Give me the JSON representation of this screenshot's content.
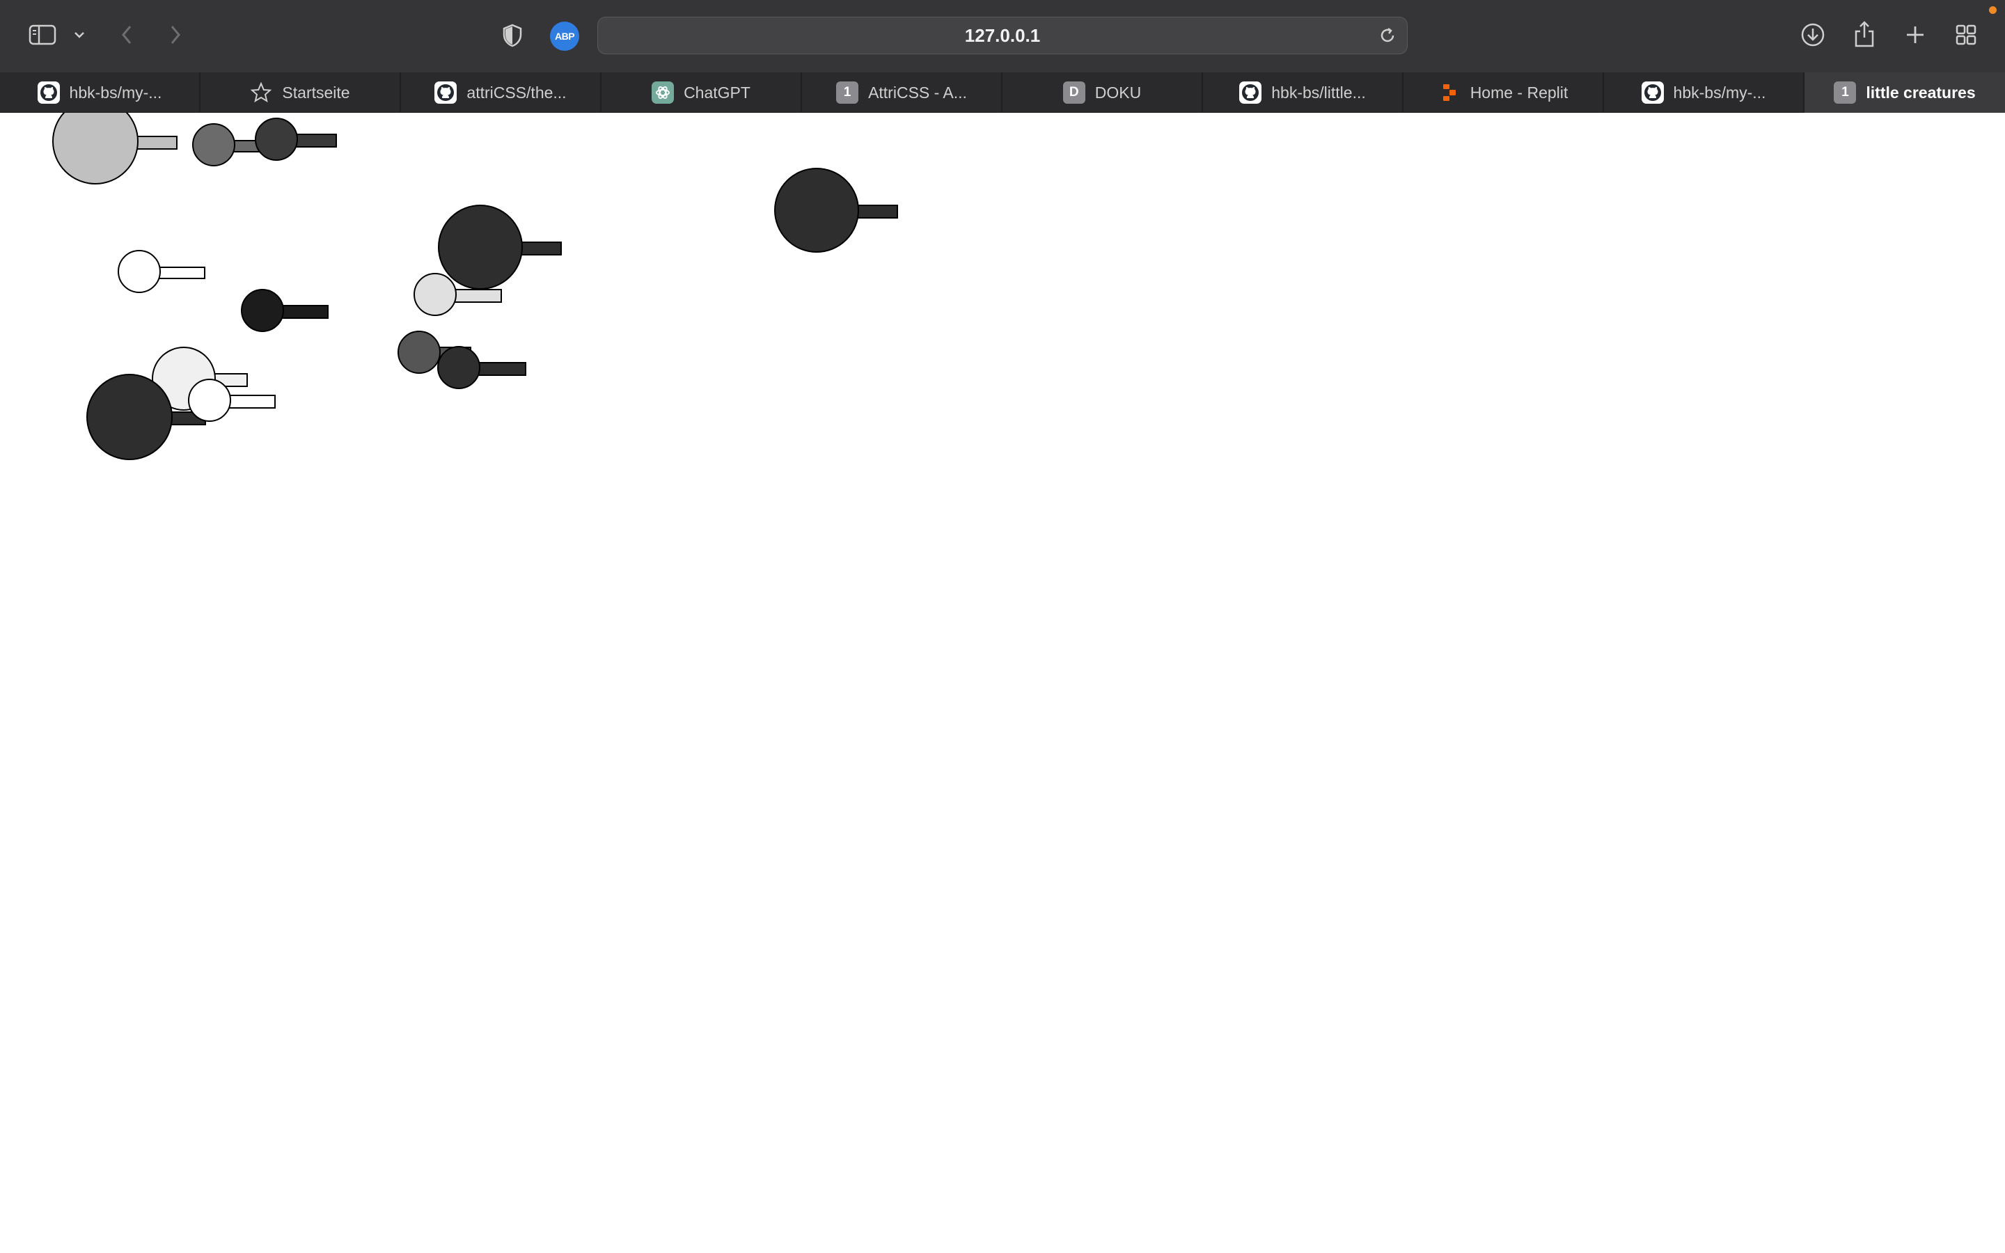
{
  "browser": {
    "address": "127.0.0.1",
    "adblock_label": "ABP",
    "accent_color": "#2f7de1",
    "notification_color": "#f08a24"
  },
  "tabs": [
    {
      "label": "hbk-bs/my-...",
      "icon": "github-icon",
      "active": false
    },
    {
      "label": "Startseite",
      "icon": "star-icon",
      "active": false
    },
    {
      "label": "attriCSS/the...",
      "icon": "github-icon",
      "active": false
    },
    {
      "label": "ChatGPT",
      "icon": "chatgpt-icon",
      "active": false
    },
    {
      "label": "AttriCSS - A...",
      "icon": "one-icon",
      "badge": "1",
      "active": false
    },
    {
      "label": "DOKU",
      "icon": "doku-icon",
      "badge": "D",
      "active": false
    },
    {
      "label": "hbk-bs/little...",
      "icon": "github-icon",
      "active": false
    },
    {
      "label": "Home - Replit",
      "icon": "replit-icon",
      "active": false
    },
    {
      "label": "hbk-bs/my-...",
      "icon": "github-icon",
      "active": false
    },
    {
      "label": "little creatures",
      "icon": "one-icon",
      "badge": "1",
      "active": true
    }
  ],
  "creatures": [
    {
      "color": "#c0c0c0"
    },
    {
      "color": "#6b6b6b"
    },
    {
      "color": "#3a3a3a"
    },
    {
      "color": "#2e2e2e"
    },
    {
      "color": "#ffffff"
    },
    {
      "color": "#1c1c1c"
    },
    {
      "color": "#2e2e2e"
    },
    {
      "color": "#e0e0e0"
    },
    {
      "color": "#555555"
    },
    {
      "color": "#2e2e2e"
    },
    {
      "color": "#f0f0f0"
    },
    {
      "color": "#2e2e2e"
    },
    {
      "color": "#ffffff"
    }
  ]
}
